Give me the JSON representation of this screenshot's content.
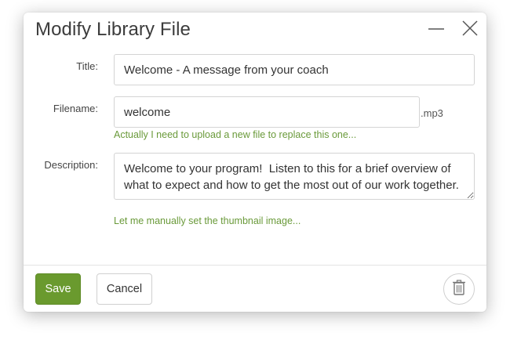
{
  "dialog": {
    "title": "Modify Library File"
  },
  "form": {
    "title_label": "Title:",
    "title_value": "Welcome - A message from your coach",
    "filename_label": "Filename:",
    "filename_value": "welcome",
    "filename_ext": ".mp3",
    "replace_file_link": "Actually I need to upload a new file to replace this one...",
    "description_label": "Description:",
    "description_value": "Welcome to your program!  Listen to this for a brief overview of what to expect and how to get the most out of our work together.",
    "thumbnail_link": "Let me manually set the thumbnail image..."
  },
  "footer": {
    "save_label": "Save",
    "cancel_label": "Cancel"
  },
  "icons": {
    "minimize": "minimize-icon",
    "close": "close-icon",
    "delete": "trash-icon"
  },
  "colors": {
    "accent_green": "#6a9a2e",
    "link_green": "#6a9a3a"
  }
}
